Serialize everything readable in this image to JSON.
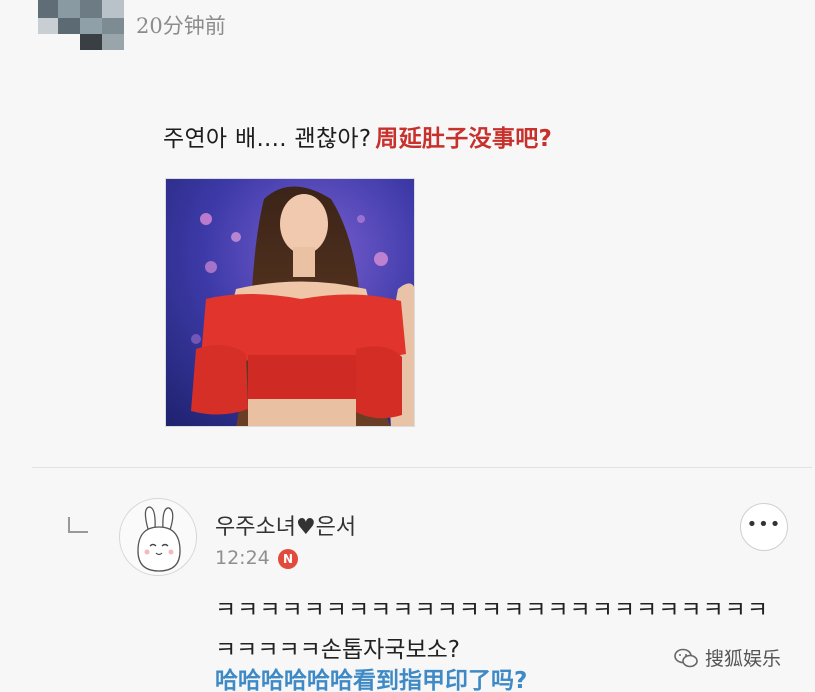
{
  "header": {
    "timestamp": "20分钟前"
  },
  "post": {
    "text_ko": "주연아 배.... 괜찮아?",
    "text_cn": "周延肚子没事吧?"
  },
  "comment": {
    "username": "우주소녀♥은서",
    "time": "12:24",
    "new_badge": "N",
    "more_label": "•••",
    "line1": "ㅋㅋㅋㅋㅋㅋㅋㅋㅋㅋㅋㅋㅋㅋㅋㅋㅋㅋㅋㅋㅋㅋㅋㅋㅋ",
    "line2": "ㅋㅋㅋㅋㅋ손톱자국보소?",
    "translation": "哈哈哈哈哈哈看到指甲印了吗?"
  },
  "watermark": {
    "text": "搜狐娱乐"
  },
  "colors": {
    "accent_red": "#c8302c",
    "translation_blue": "#3e8ac6",
    "badge_red": "#e24a3b"
  }
}
